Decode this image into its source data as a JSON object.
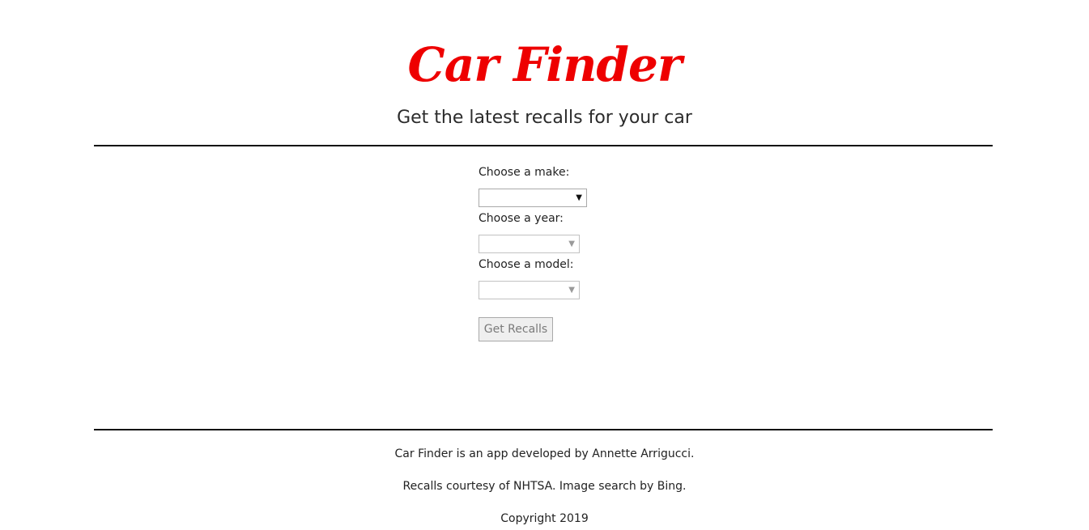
{
  "header": {
    "title": "Car Finder",
    "subtitle": "Get the latest recalls for your car"
  },
  "form": {
    "make_label": "Choose a make:",
    "make_value": "",
    "year_label": "Choose a year:",
    "year_value": "",
    "model_label": "Choose a model:",
    "model_value": "",
    "dropdown_arrow": "▼",
    "submit_label": "Get Recalls"
  },
  "footer": {
    "credit": "Car Finder is an app developed by Annette Arrigucci.",
    "sources": "Recalls courtesy of NHTSA. Image search by Bing.",
    "copyright": "Copyright 2019"
  },
  "colors": {
    "title": "#ee0000",
    "divider": "#111111",
    "button_bg": "#efefef",
    "button_text": "#7a7a7a"
  }
}
